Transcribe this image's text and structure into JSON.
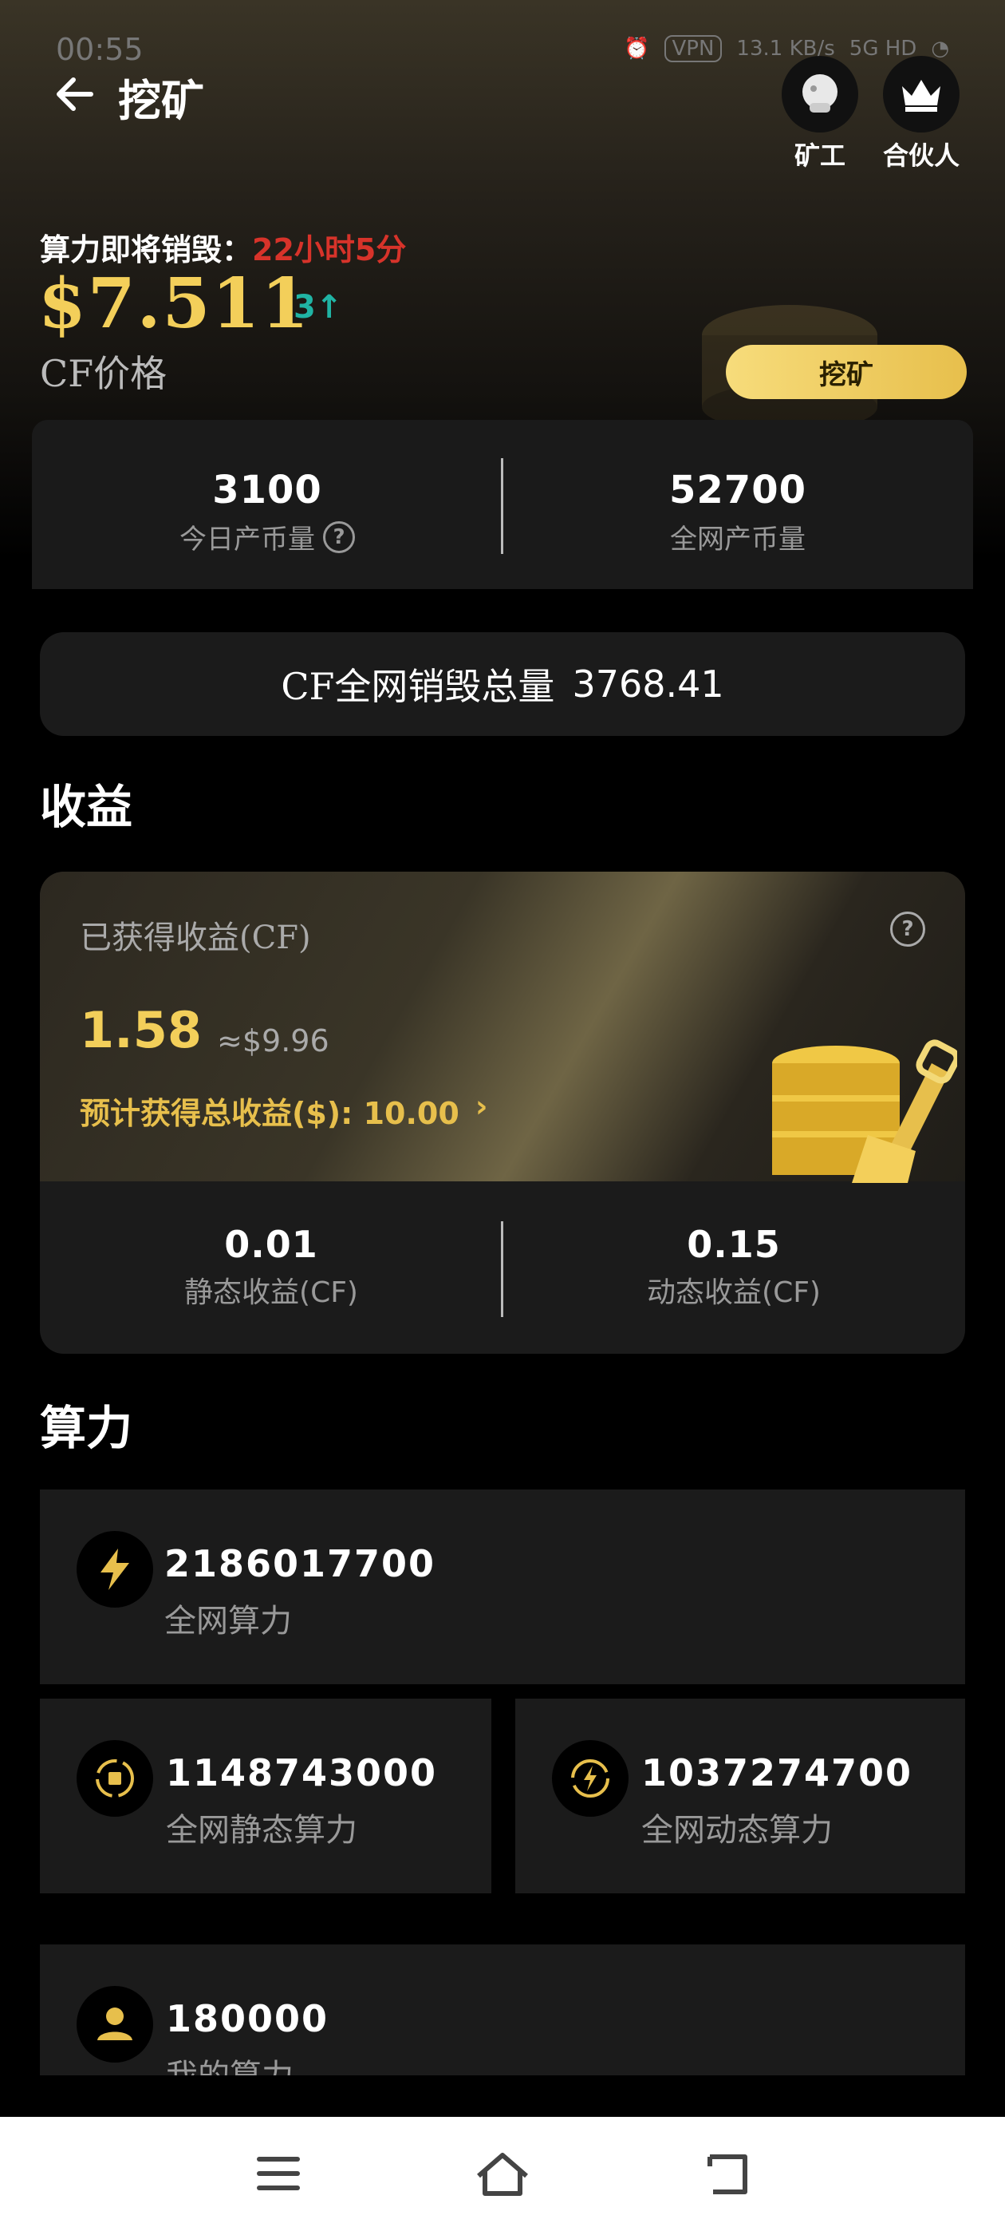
{
  "status_bar": {
    "time": "00:55",
    "network": "VPN",
    "speed": "13.1 KB/s",
    "signal": "5G HD"
  },
  "header": {
    "title": "挖矿",
    "miner_label": "矿工",
    "partner_label": "合伙人"
  },
  "hero": {
    "burn_label": "算力即将销毁：",
    "burn_time": "22小时5分",
    "price": "$7.511",
    "price_change": "3↑",
    "price_label": "CF价格",
    "mine_button": "挖矿"
  },
  "stats": [
    {
      "value": "3100",
      "label": "今日产币量"
    },
    {
      "value": "52700",
      "label": "全网产币量"
    }
  ],
  "burn_total": {
    "label": "CF全网销毁总量",
    "value": "3768.41"
  },
  "earnings": {
    "section_title": "收益",
    "label": "已获得收益(CF)",
    "value": "1.58",
    "usd": "≈$9.96",
    "estimate": "预计获得总收益($): 10.00",
    "static_value": "0.01",
    "static_label": "静态收益(CF)",
    "dynamic_value": "0.15",
    "dynamic_label": "动态收益(CF)"
  },
  "power": {
    "section_title": "算力",
    "total_value": "2186017700",
    "total_label": "全网算力",
    "static_value": "1148743000",
    "static_label": "全网静态算力",
    "dynamic_value": "1037274700",
    "dynamic_label": "全网动态算力",
    "mine_value": "180000",
    "mine_label": "我的算力"
  },
  "colors": {
    "gold": "#f3cf5a",
    "red": "#d7332a",
    "teal": "#20b4a4"
  }
}
